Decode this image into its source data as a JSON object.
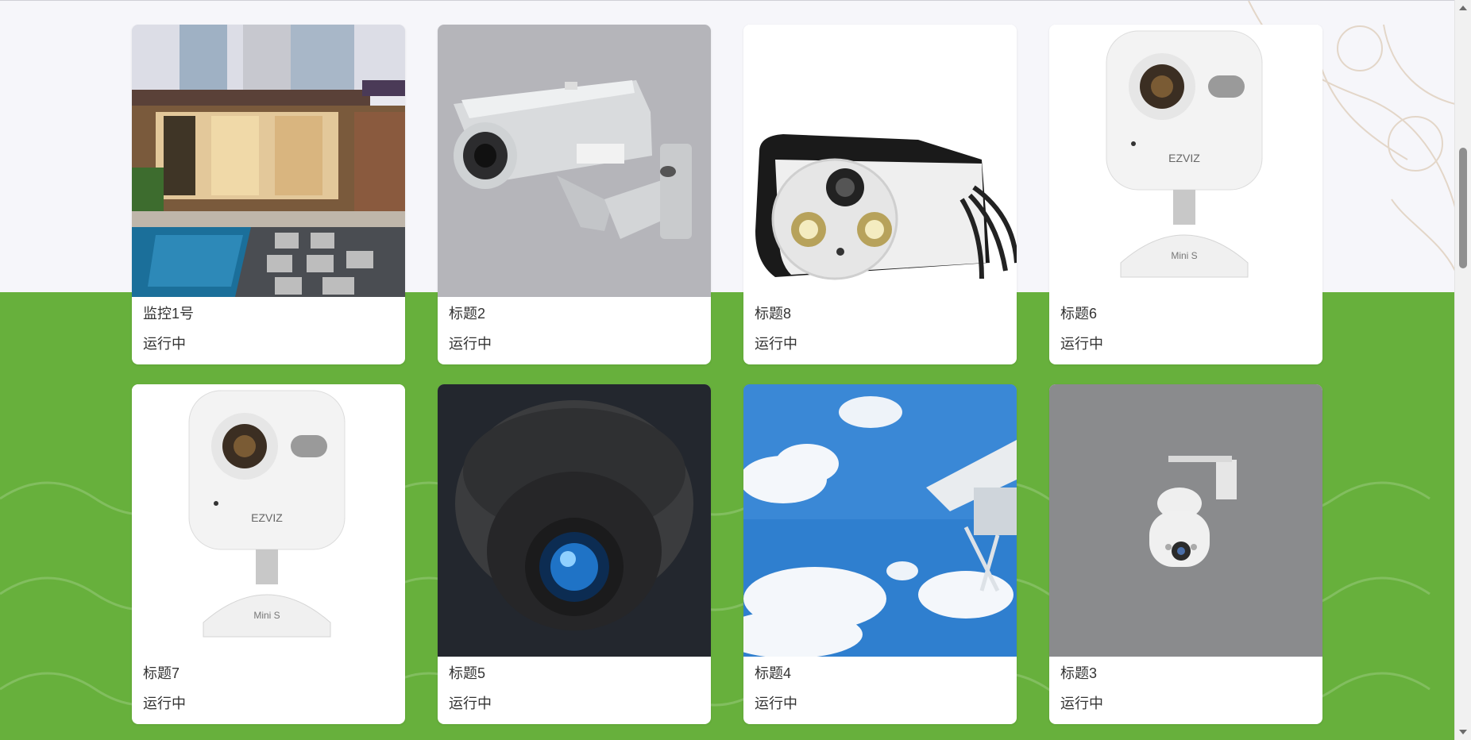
{
  "cards": [
    {
      "title": "监控1号",
      "status": "运行中",
      "image": "courtyard-pool-photo"
    },
    {
      "title": "标题2",
      "status": "运行中",
      "image": "bullet-camera-photo"
    },
    {
      "title": "标题8",
      "status": "运行中",
      "image": "box-camera-photo"
    },
    {
      "title": "标题6",
      "status": "运行中",
      "image": "ezviz-mini-camera-photo"
    },
    {
      "title": "标题7",
      "status": "运行中",
      "image": "ezviz-mini-camera-photo"
    },
    {
      "title": "标题5",
      "status": "运行中",
      "image": "dome-camera-icon-image"
    },
    {
      "title": "标题4",
      "status": "运行中",
      "image": "sky-camera-photo"
    },
    {
      "title": "标题3",
      "status": "运行中",
      "image": "ptz-camera-photo"
    }
  ],
  "colors": {
    "page_top": "#f6f6fa",
    "page_bottom": "#67b03c",
    "card": "#ffffff",
    "text": "#333333"
  }
}
